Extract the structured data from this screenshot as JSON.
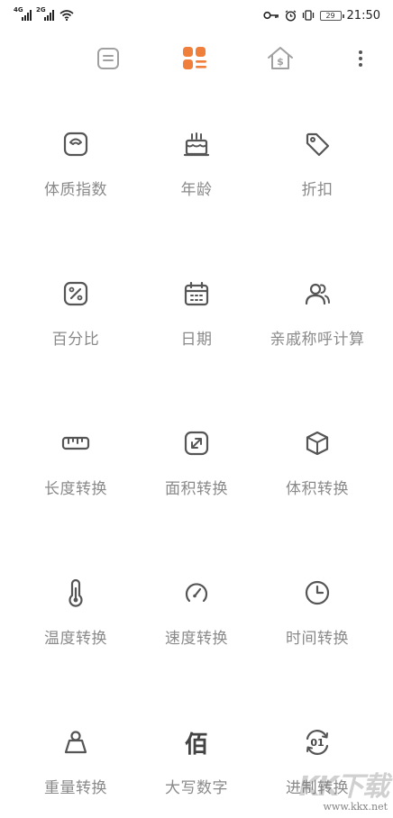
{
  "status_bar": {
    "sim1_tag": "4G",
    "sim2_tag": "2G",
    "battery": "29",
    "time": "21:50"
  },
  "topbar": {
    "tabs": [
      {
        "icon": "list-icon",
        "active": false
      },
      {
        "icon": "grid-apps-icon",
        "active": true
      },
      {
        "icon": "house-dollar-icon",
        "active": false
      }
    ],
    "more_icon": "more-vertical-icon"
  },
  "colors": {
    "accent": "#F07F3C",
    "icon_gray": "#555555",
    "label_gray": "#8a8a8a",
    "inactive_tab": "#a0a0a0"
  },
  "tools": [
    {
      "label": "体质指数",
      "icon": "scale-icon"
    },
    {
      "label": "年龄",
      "icon": "birthday-cake-icon"
    },
    {
      "label": "折扣",
      "icon": "price-tag-icon"
    },
    {
      "label": "百分比",
      "icon": "percent-icon"
    },
    {
      "label": "日期",
      "icon": "calendar-icon"
    },
    {
      "label": "亲戚称呼计算",
      "icon": "people-icon"
    },
    {
      "label": "长度转换",
      "icon": "ruler-icon"
    },
    {
      "label": "面积转换",
      "icon": "expand-arrow-icon"
    },
    {
      "label": "体积转换",
      "icon": "cube-icon"
    },
    {
      "label": "温度转换",
      "icon": "thermometer-icon"
    },
    {
      "label": "速度转换",
      "icon": "speedometer-icon"
    },
    {
      "label": "时间转换",
      "icon": "clock-icon"
    },
    {
      "label": "重量转换",
      "icon": "weight-icon"
    },
    {
      "label": "大写数字",
      "icon": "chinese-numeral-icon",
      "glyph": "佰"
    },
    {
      "label": "进制转换",
      "icon": "binary-cycle-icon",
      "glyph": "01"
    }
  ],
  "watermark": {
    "big": "KK下载",
    "url": "www.kkx.net"
  }
}
